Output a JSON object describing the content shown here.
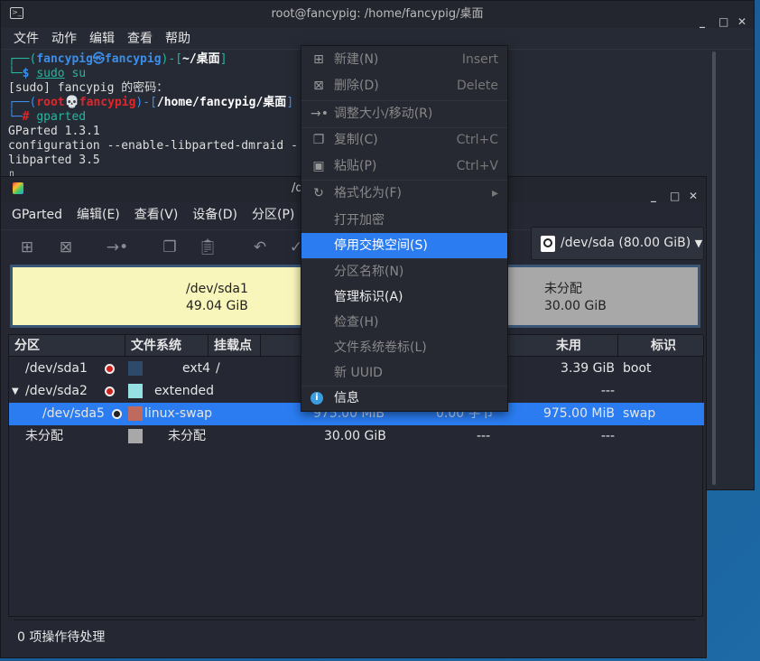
{
  "terminal": {
    "title": "root@fancypig: /home/fancypig/桌面",
    "menu": [
      "文件",
      "动作",
      "编辑",
      "查看",
      "帮助"
    ],
    "lines": {
      "l1a": "┌──(",
      "l1user": "fancypig㉿fancypig",
      "l1b": ")-[",
      "l1dir": "~/桌面",
      "l1c": "]",
      "l2a": "└─",
      "l2p": "$ ",
      "l2cmd": "sudo",
      "l2rest": " su",
      "l3": "[sudo] fancypig 的密码：",
      "l4a": "┌──(",
      "l4user": "root💀fancypig",
      "l4b": ")-[",
      "l4dir": "/home/fancypig/桌面",
      "l4c": "]",
      "l5a": "└─",
      "l5p": "# ",
      "l5cmd": "gparted",
      "l6": "GParted 1.3.1",
      "l7": "configuration --enable-libparted-dmraid -",
      "l8": "libparted 3.5",
      "l9": "▯"
    }
  },
  "gparted": {
    "title": "/d",
    "menu": [
      "GParted",
      "编辑(E)",
      "查看(V)",
      "设备(D)",
      "分区(P)"
    ],
    "device": "/dev/sda (80.00 GiB)",
    "graph": {
      "sda1_name": "/dev/sda1",
      "sda1_size": "49.04 GiB",
      "unalloc_name": "未分配",
      "unalloc_size": "30.00 GiB"
    },
    "columns": [
      "分区",
      "文件系统",
      "挂载点",
      "未用",
      "标识"
    ],
    "rows": [
      {
        "part": "/dev/sda1",
        "fs": "ext4",
        "mount": "/",
        "size": "",
        "used": "",
        "unused": "3.39 GiB",
        "flags": "boot",
        "color": "#2e4a6b"
      },
      {
        "part": "/dev/sda2",
        "fs": "extended",
        "mount": "",
        "size": "",
        "used": "",
        "unused": "---",
        "flags": "",
        "color": "#96e0e4"
      },
      {
        "part": "/dev/sda5",
        "fs": "linux-swap",
        "mount": "",
        "size": "975.00 MiB",
        "used": "0.00 字节",
        "unused": "975.00 MiB",
        "flags": "swap",
        "color": "#c06a5e"
      },
      {
        "part": "未分配",
        "fs": "未分配",
        "mount": "",
        "size": "30.00 GiB",
        "used": "---",
        "unused": "---",
        "flags": "",
        "color": "#a8a8a8"
      }
    ],
    "status": "0 项操作待处理"
  },
  "context_menu": [
    {
      "label": "新建(N)",
      "shortcut": "Insert",
      "enabled": false,
      "icon": "new-icon"
    },
    {
      "label": "删除(D)",
      "shortcut": "Delete",
      "enabled": false,
      "icon": "delete-icon"
    },
    {
      "label": "调整大小/移动(R)",
      "shortcut": "",
      "enabled": false,
      "icon": "resize-icon"
    },
    {
      "label": "复制(C)",
      "shortcut": "Ctrl+C",
      "enabled": false,
      "icon": "copy-icon"
    },
    {
      "label": "粘贴(P)",
      "shortcut": "Ctrl+V",
      "enabled": false,
      "icon": "paste-icon"
    },
    {
      "label": "格式化为(F)",
      "shortcut": "▸",
      "enabled": false,
      "icon": "format-icon"
    },
    {
      "label": "打开加密",
      "shortcut": "",
      "enabled": false
    },
    {
      "label": "停用交换空间(S)",
      "shortcut": "",
      "enabled": true,
      "highlighted": true
    },
    {
      "label": "分区名称(N)",
      "shortcut": "",
      "enabled": false
    },
    {
      "label": "管理标识(A)",
      "shortcut": "",
      "enabled": true
    },
    {
      "label": "检查(H)",
      "shortcut": "",
      "enabled": false
    },
    {
      "label": "文件系统卷标(L)",
      "shortcut": "",
      "enabled": false
    },
    {
      "label": "新 UUID",
      "shortcut": "",
      "enabled": false
    },
    {
      "label": "信息",
      "shortcut": "",
      "enabled": true,
      "icon": "info-icon"
    }
  ]
}
